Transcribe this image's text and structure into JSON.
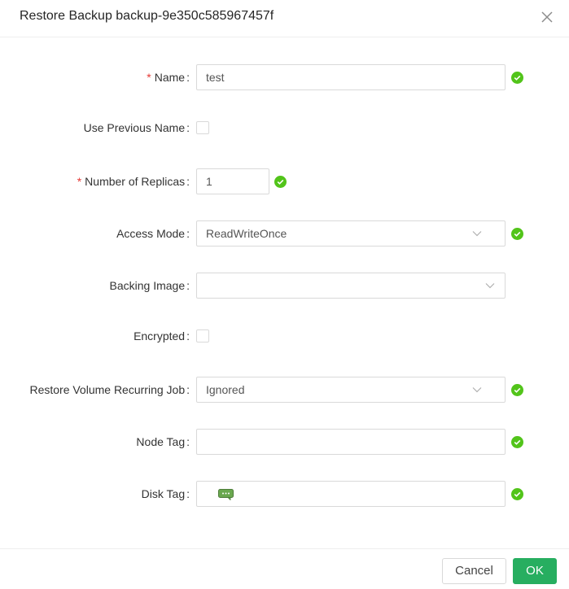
{
  "modal": {
    "title": "Restore Backup backup-9e350c585967457f"
  },
  "form": {
    "name": {
      "label": "Name",
      "required_mark": "*",
      "value": "test"
    },
    "use_previous_name": {
      "label": "Use Previous Name"
    },
    "replicas": {
      "label": "Number of Replicas",
      "required_mark": "*",
      "value": "1"
    },
    "access_mode": {
      "label": "Access Mode",
      "value": "ReadWriteOnce"
    },
    "backing_image": {
      "label": "Backing Image",
      "value": ""
    },
    "encrypted": {
      "label": "Encrypted"
    },
    "recurring_job": {
      "label": "Restore Volume Recurring Job",
      "value": "Ignored"
    },
    "node_tag": {
      "label": "Node Tag",
      "value": ""
    },
    "disk_tag": {
      "label": "Disk Tag",
      "value": ""
    },
    "colon": ":"
  },
  "footer": {
    "cancel_label": "Cancel",
    "ok_label": "OK"
  },
  "colors": {
    "accent": "#27ae60",
    "validation_ok": "#52c41a",
    "required": "#e53935",
    "border": "#d9d9d9"
  },
  "icons": {
    "close": "close-icon",
    "validation": "check-circle-icon",
    "dropdown": "chevron-down-icon",
    "disk_tag": "chat-bubble-icon"
  }
}
